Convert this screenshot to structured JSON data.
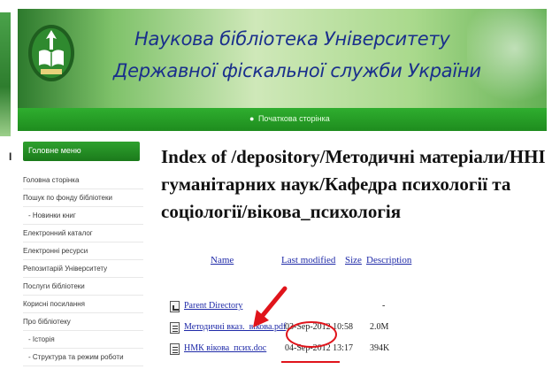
{
  "left_fragment": "І",
  "header": {
    "title_line1": "Наукова бібліотека Університету",
    "title_line2": "Державної фіскальної служби України"
  },
  "navbar": {
    "home_link": "Початкова сторінка"
  },
  "sidebar": {
    "menu_head": "Головне меню",
    "items": [
      {
        "label": "Головна сторінка"
      },
      {
        "label": "Пошук по фонду бібліотеки"
      },
      {
        "label": "- Новинки книг"
      },
      {
        "label": "Електронний каталог"
      },
      {
        "label": "Електронні ресурси"
      },
      {
        "label": "Репозитарій Університету"
      },
      {
        "label": "Послуги бібліотеки"
      },
      {
        "label": "Корисні посилання"
      },
      {
        "label": "Про бібліотеку"
      },
      {
        "label": "- Історія"
      },
      {
        "label": "- Структура та режим роботи"
      }
    ]
  },
  "main": {
    "title_line1": "Index of /depository/Методичні матеріали/ННІ",
    "title_line2": "гуманітарних наук/Кафедра психології та",
    "title_line3": "соціології/вікова_психологія",
    "columns": {
      "name": "Name",
      "last_modified": "Last modified",
      "size": "Size",
      "description": "Description"
    },
    "rows": [
      {
        "icon": "back-icon",
        "name": "Parent Directory",
        "date": "",
        "size": "-"
      },
      {
        "icon": "file-icon",
        "name": "Методичні вказ._вікова.pdf",
        "date": "03-Sep-2012 10:58",
        "size": "2.0M"
      },
      {
        "icon": "file-icon",
        "name": "НМК вікова_псих.doc",
        "date": "04-Sep-2012 13:17",
        "size": "394K"
      }
    ]
  },
  "colors": {
    "header_green": "#2d7a2d",
    "navbar_green": "#1e8c1e",
    "title_blue": "#1a2f8c",
    "link_blue": "#1f2aa8",
    "annotation_red": "#e0141b"
  }
}
